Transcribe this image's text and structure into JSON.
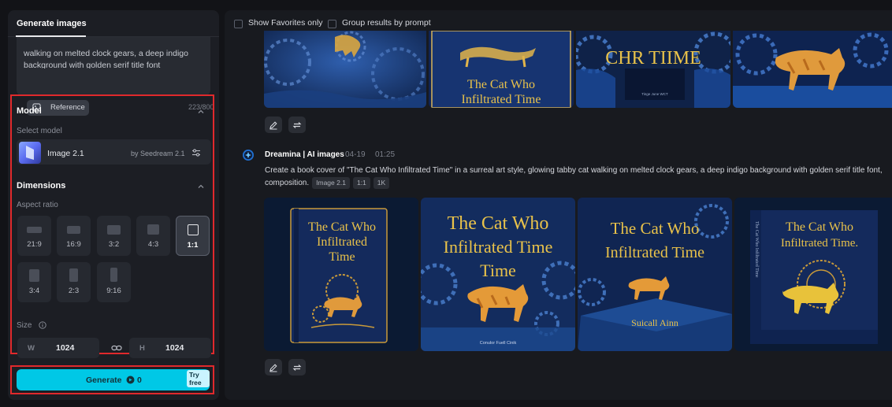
{
  "left_panel": {
    "tab_label": "Generate images",
    "prompt_visible": "walking on melted clock gears, a deep indigo background with golden serif title font",
    "reference_label": "Reference",
    "char_count": "223/800",
    "model_section": {
      "title": "Model",
      "select_label": "Select model",
      "model_name": "Image 2.1",
      "model_by": "by Seedream 2.1"
    },
    "dimensions_section": {
      "title": "Dimensions",
      "aspect_label": "Aspect ratio",
      "ratios": [
        {
          "label": "21:9",
          "selected": false
        },
        {
          "label": "16:9",
          "selected": false
        },
        {
          "label": "3:2",
          "selected": false
        },
        {
          "label": "4:3",
          "selected": false
        },
        {
          "label": "1:1",
          "selected": true
        },
        {
          "label": "3:4",
          "selected": false
        },
        {
          "label": "2:3",
          "selected": false
        },
        {
          "label": "9:16",
          "selected": false
        }
      ],
      "size_label": "Size",
      "width_key": "W",
      "width_value": "1024",
      "height_key": "H",
      "height_value": "1024"
    },
    "generate": {
      "label": "Generate",
      "cost": "0",
      "badge": "Try free"
    }
  },
  "right_panel": {
    "filters": {
      "favorites_label": "Show Favorites only",
      "group_label": "Group results by prompt"
    },
    "top_group": {
      "cover_title_1": "The Cat Who",
      "cover_title_2": "Infiltrated Time",
      "cover_title_3": "CHR TIIME",
      "cover_subtitle_3": "Tinge June WCT"
    },
    "entry": {
      "source": "Dreamina | AI images",
      "date": "04-19",
      "time": "01:25",
      "prompt_line1": "Create a book cover of \"The Cat Who Infiltrated Time\" in a surreal art style, glowing tabby cat walking on melted clock gears, a deep indigo background with golden serif title font,",
      "prompt_line2": "composition.",
      "tags": [
        "Image 2.1",
        "1:1",
        "1K"
      ]
    },
    "covers": [
      {
        "line1": "The Cat Who",
        "line2": "Infiltrated",
        "line3": "Time",
        "footer": ""
      },
      {
        "line1": "The Cat Who",
        "line2": "Infiltrated Time",
        "line3": "Time",
        "footer": "Conulor Fuell Cinik"
      },
      {
        "line1": "The Cat Who",
        "line2": "Infiltrated Time",
        "line3": "",
        "footer": "Suicall Ainn"
      },
      {
        "line1": "The Cat Who",
        "line2": "Infiltrated Time.",
        "line3": "",
        "footer": ""
      }
    ],
    "spine_text": "The Cat Who Infiltrated Time"
  },
  "colors": {
    "accent": "#00c8e6",
    "highlight_border": "#e0292c",
    "panel_bg": "#1c1e24",
    "gold": "#e9c24a",
    "indigo": "#142a5c"
  }
}
